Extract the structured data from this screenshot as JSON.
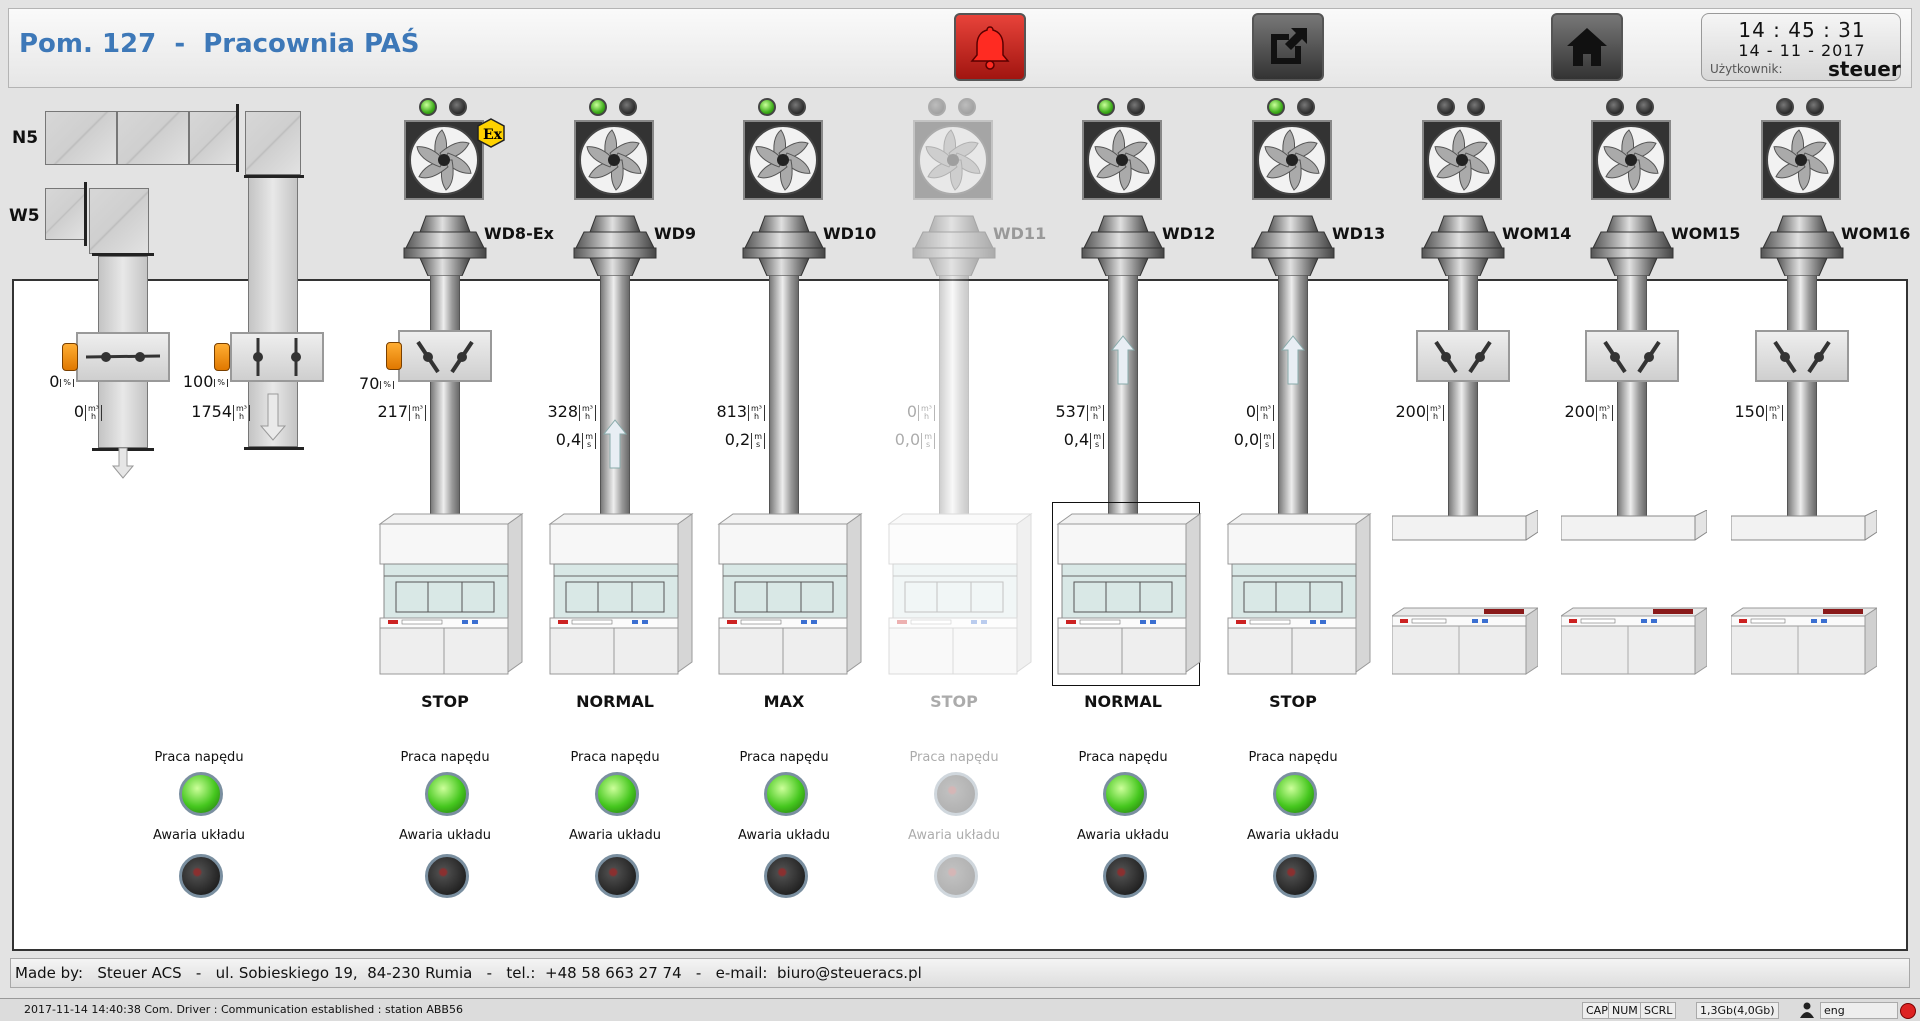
{
  "header": {
    "title": "Pom. 127  -  Pracownia PAŚ",
    "alarm_icon": "bell-icon",
    "export_icon": "external-link-icon",
    "home_icon": "home-icon",
    "clock_time": "14 : 45 : 31",
    "clock_date": "14 - 11 - 2017",
    "user_label": "Użytkownik:",
    "user_name": "steuer"
  },
  "ducts": {
    "n5_label": "N5",
    "w5_label": "W5",
    "w5_damper_pct": "0",
    "w5_flow": "0",
    "n5_damper_pct": "100",
    "n5_flow": "1754"
  },
  "units_text": {
    "pct": "%",
    "flow_num": "m³",
    "flow_den": "h",
    "vel_num": "m",
    "vel_den": "s",
    "run_label": "Praca napędu",
    "fault_label": "Awaria układu"
  },
  "side_status": {
    "run_label": "Praca napędu",
    "fault_label": "Awaria układu"
  },
  "units": [
    {
      "name": "WD8-Ex",
      "ex": true,
      "led1": "green",
      "led2": "dark",
      "damper_pct": "70",
      "flow": "217",
      "velocity": "",
      "mode": "STOP",
      "type": "fumehood",
      "dim": false,
      "run": "green",
      "fault": "dark",
      "selected": false,
      "arrow": "none",
      "angle_open": true
    },
    {
      "name": "WD9",
      "ex": false,
      "led1": "green",
      "led2": "dark",
      "damper_pct": "",
      "flow": "328",
      "velocity": "0,4",
      "mode": "NORMAL",
      "type": "fumehood",
      "dim": false,
      "run": "green",
      "fault": "dark",
      "selected": false,
      "arrow": "up",
      "angle_open": false
    },
    {
      "name": "WD10",
      "ex": false,
      "led1": "green",
      "led2": "dark",
      "damper_pct": "",
      "flow": "813",
      "velocity": "0,2",
      "mode": "MAX",
      "type": "fumehood",
      "dim": false,
      "run": "green",
      "fault": "dark",
      "selected": false,
      "arrow": "none",
      "angle_open": false
    },
    {
      "name": "WD11",
      "ex": false,
      "led1": "dark",
      "led2": "dark",
      "damper_pct": "",
      "flow": "0",
      "velocity": "0,0",
      "mode": "STOP",
      "type": "fumehood",
      "dim": true,
      "run": "dark",
      "fault": "dark",
      "selected": false,
      "arrow": "none",
      "angle_open": false
    },
    {
      "name": "WD12",
      "ex": false,
      "led1": "green",
      "led2": "dark",
      "damper_pct": "",
      "flow": "537",
      "velocity": "0,4",
      "mode": "NORMAL",
      "type": "fumehood",
      "dim": false,
      "run": "green",
      "fault": "dark",
      "selected": true,
      "arrow": "up",
      "angle_open": false
    },
    {
      "name": "WD13",
      "ex": false,
      "led1": "green",
      "led2": "dark",
      "damper_pct": "",
      "flow": "0",
      "velocity": "0,0",
      "mode": "STOP",
      "type": "fumehood",
      "dim": false,
      "run": "green",
      "fault": "dark",
      "selected": false,
      "arrow": "up",
      "angle_open": false
    },
    {
      "name": "WOM14",
      "ex": false,
      "led1": "dark",
      "led2": "dark",
      "damper_pct": "",
      "flow": "200",
      "velocity": "",
      "mode": "",
      "type": "capture",
      "dim": false,
      "run": "",
      "fault": "",
      "selected": false,
      "arrow": "none",
      "angle_open": true
    },
    {
      "name": "WOM15",
      "ex": false,
      "led1": "dark",
      "led2": "dark",
      "damper_pct": "",
      "flow": "200",
      "velocity": "",
      "mode": "",
      "type": "capture",
      "dim": false,
      "run": "",
      "fault": "",
      "selected": false,
      "arrow": "none",
      "angle_open": true
    },
    {
      "name": "WOM16",
      "ex": false,
      "led1": "dark",
      "led2": "dark",
      "damper_pct": "",
      "flow": "150",
      "velocity": "",
      "mode": "",
      "type": "capture",
      "dim": false,
      "run": "",
      "fault": "",
      "selected": false,
      "arrow": "none",
      "angle_open": true
    }
  ],
  "footer": {
    "text": "Made by:   Steuer ACS   -   ul. Sobieskiego 19,  84-230 Rumia   -   tel.:  +48 58 663 27 74   -   e-mail:  biuro@steueracs.pl"
  },
  "statusbar": {
    "message": "2017-11-14 14:40:38 Com. Driver : Communication established : station ABB56",
    "cap": "CAP",
    "num": "NUM",
    "scrl": "SCRL",
    "memory": "1,3Gb(4,0Gb)",
    "lang": "eng"
  },
  "colors": {
    "title_blue": "#3d78b8",
    "alarm_red": "#d02a20",
    "led_green": "#45c71e"
  }
}
